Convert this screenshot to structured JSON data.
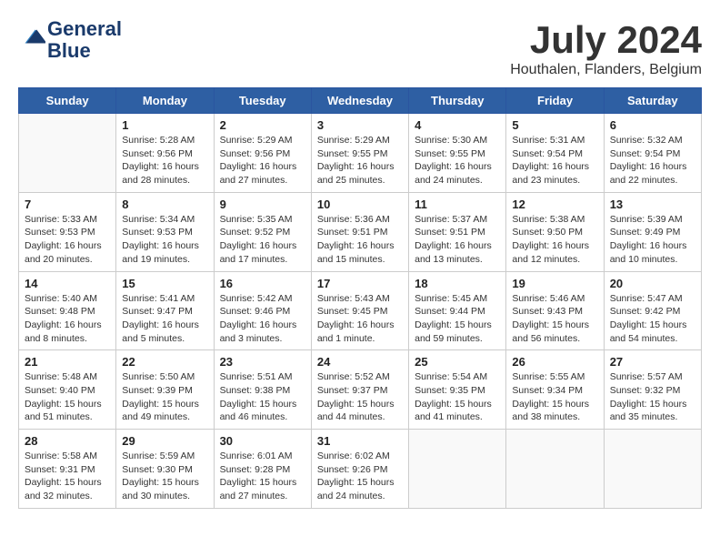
{
  "logo": {
    "line1": "General",
    "line2": "Blue"
  },
  "title": "July 2024",
  "subtitle": "Houthalen, Flanders, Belgium",
  "days_of_week": [
    "Sunday",
    "Monday",
    "Tuesday",
    "Wednesday",
    "Thursday",
    "Friday",
    "Saturday"
  ],
  "weeks": [
    [
      {
        "day": "",
        "info": ""
      },
      {
        "day": "1",
        "info": "Sunrise: 5:28 AM\nSunset: 9:56 PM\nDaylight: 16 hours\nand 28 minutes."
      },
      {
        "day": "2",
        "info": "Sunrise: 5:29 AM\nSunset: 9:56 PM\nDaylight: 16 hours\nand 27 minutes."
      },
      {
        "day": "3",
        "info": "Sunrise: 5:29 AM\nSunset: 9:55 PM\nDaylight: 16 hours\nand 25 minutes."
      },
      {
        "day": "4",
        "info": "Sunrise: 5:30 AM\nSunset: 9:55 PM\nDaylight: 16 hours\nand 24 minutes."
      },
      {
        "day": "5",
        "info": "Sunrise: 5:31 AM\nSunset: 9:54 PM\nDaylight: 16 hours\nand 23 minutes."
      },
      {
        "day": "6",
        "info": "Sunrise: 5:32 AM\nSunset: 9:54 PM\nDaylight: 16 hours\nand 22 minutes."
      }
    ],
    [
      {
        "day": "7",
        "info": "Sunrise: 5:33 AM\nSunset: 9:53 PM\nDaylight: 16 hours\nand 20 minutes."
      },
      {
        "day": "8",
        "info": "Sunrise: 5:34 AM\nSunset: 9:53 PM\nDaylight: 16 hours\nand 19 minutes."
      },
      {
        "day": "9",
        "info": "Sunrise: 5:35 AM\nSunset: 9:52 PM\nDaylight: 16 hours\nand 17 minutes."
      },
      {
        "day": "10",
        "info": "Sunrise: 5:36 AM\nSunset: 9:51 PM\nDaylight: 16 hours\nand 15 minutes."
      },
      {
        "day": "11",
        "info": "Sunrise: 5:37 AM\nSunset: 9:51 PM\nDaylight: 16 hours\nand 13 minutes."
      },
      {
        "day": "12",
        "info": "Sunrise: 5:38 AM\nSunset: 9:50 PM\nDaylight: 16 hours\nand 12 minutes."
      },
      {
        "day": "13",
        "info": "Sunrise: 5:39 AM\nSunset: 9:49 PM\nDaylight: 16 hours\nand 10 minutes."
      }
    ],
    [
      {
        "day": "14",
        "info": "Sunrise: 5:40 AM\nSunset: 9:48 PM\nDaylight: 16 hours\nand 8 minutes."
      },
      {
        "day": "15",
        "info": "Sunrise: 5:41 AM\nSunset: 9:47 PM\nDaylight: 16 hours\nand 5 minutes."
      },
      {
        "day": "16",
        "info": "Sunrise: 5:42 AM\nSunset: 9:46 PM\nDaylight: 16 hours\nand 3 minutes."
      },
      {
        "day": "17",
        "info": "Sunrise: 5:43 AM\nSunset: 9:45 PM\nDaylight: 16 hours\nand 1 minute."
      },
      {
        "day": "18",
        "info": "Sunrise: 5:45 AM\nSunset: 9:44 PM\nDaylight: 15 hours\nand 59 minutes."
      },
      {
        "day": "19",
        "info": "Sunrise: 5:46 AM\nSunset: 9:43 PM\nDaylight: 15 hours\nand 56 minutes."
      },
      {
        "day": "20",
        "info": "Sunrise: 5:47 AM\nSunset: 9:42 PM\nDaylight: 15 hours\nand 54 minutes."
      }
    ],
    [
      {
        "day": "21",
        "info": "Sunrise: 5:48 AM\nSunset: 9:40 PM\nDaylight: 15 hours\nand 51 minutes."
      },
      {
        "day": "22",
        "info": "Sunrise: 5:50 AM\nSunset: 9:39 PM\nDaylight: 15 hours\nand 49 minutes."
      },
      {
        "day": "23",
        "info": "Sunrise: 5:51 AM\nSunset: 9:38 PM\nDaylight: 15 hours\nand 46 minutes."
      },
      {
        "day": "24",
        "info": "Sunrise: 5:52 AM\nSunset: 9:37 PM\nDaylight: 15 hours\nand 44 minutes."
      },
      {
        "day": "25",
        "info": "Sunrise: 5:54 AM\nSunset: 9:35 PM\nDaylight: 15 hours\nand 41 minutes."
      },
      {
        "day": "26",
        "info": "Sunrise: 5:55 AM\nSunset: 9:34 PM\nDaylight: 15 hours\nand 38 minutes."
      },
      {
        "day": "27",
        "info": "Sunrise: 5:57 AM\nSunset: 9:32 PM\nDaylight: 15 hours\nand 35 minutes."
      }
    ],
    [
      {
        "day": "28",
        "info": "Sunrise: 5:58 AM\nSunset: 9:31 PM\nDaylight: 15 hours\nand 32 minutes."
      },
      {
        "day": "29",
        "info": "Sunrise: 5:59 AM\nSunset: 9:30 PM\nDaylight: 15 hours\nand 30 minutes."
      },
      {
        "day": "30",
        "info": "Sunrise: 6:01 AM\nSunset: 9:28 PM\nDaylight: 15 hours\nand 27 minutes."
      },
      {
        "day": "31",
        "info": "Sunrise: 6:02 AM\nSunset: 9:26 PM\nDaylight: 15 hours\nand 24 minutes."
      },
      {
        "day": "",
        "info": ""
      },
      {
        "day": "",
        "info": ""
      },
      {
        "day": "",
        "info": ""
      }
    ]
  ]
}
